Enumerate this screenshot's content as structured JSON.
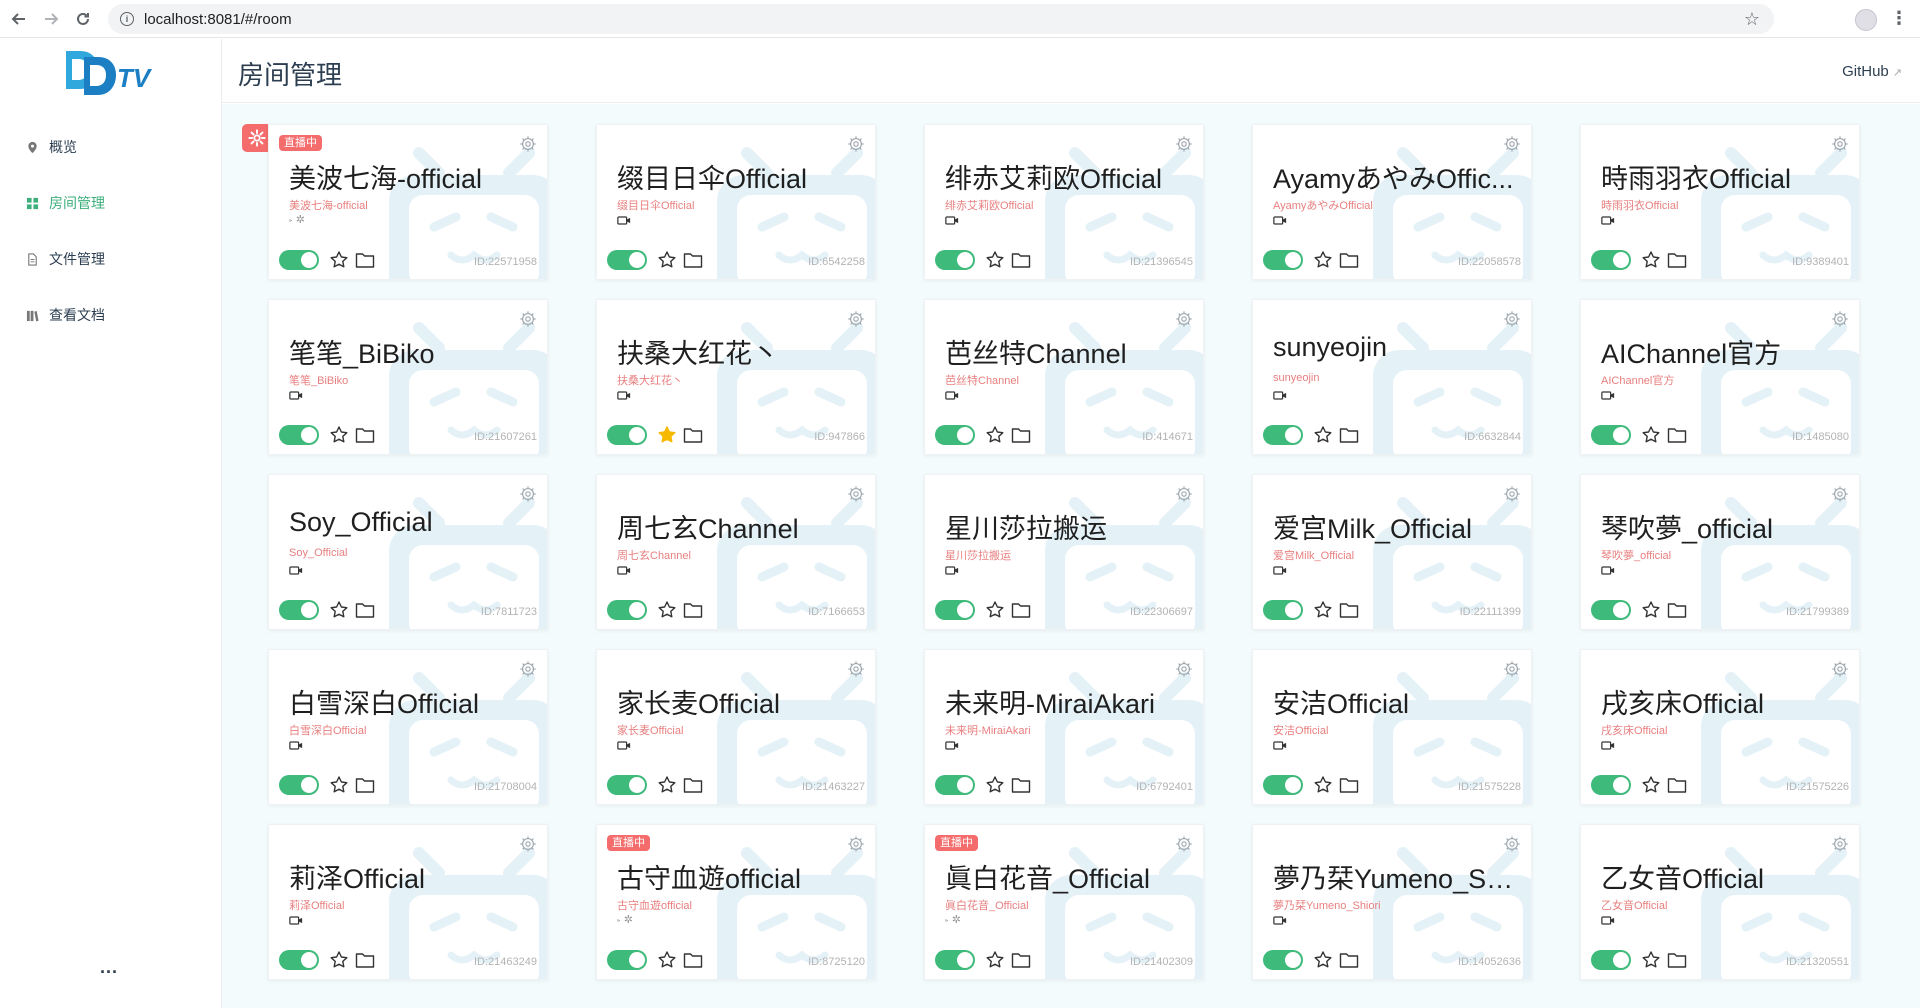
{
  "browser": {
    "url": "localhost:8081/#/room"
  },
  "sidebar": {
    "logo_text": "DDTV",
    "items": [
      {
        "label": "概览",
        "icon": "location-icon",
        "active": false
      },
      {
        "label": "房间管理",
        "icon": "grid-icon",
        "active": true
      },
      {
        "label": "文件管理",
        "icon": "file-icon",
        "active": false
      },
      {
        "label": "查看文档",
        "icon": "book-icon",
        "active": false
      }
    ],
    "more": "..."
  },
  "header": {
    "title": "房间管理",
    "github": "GitHub"
  },
  "colors": {
    "accent": "#3eaf7c",
    "toggle_on": "#3eba7b",
    "live_badge": "#f56c6c",
    "favorite": "#f7b800"
  },
  "badge_label": "直播中",
  "rooms": [
    {
      "name": "美波七海-official",
      "sub": "美波七海-official",
      "id": "ID:22571958",
      "live": true,
      "favorite": false
    },
    {
      "name": "缀目日伞Official",
      "sub": "缀目日伞Official",
      "id": "ID:6542258",
      "live": false,
      "favorite": false
    },
    {
      "name": "绯赤艾莉欧Official",
      "sub": "绯赤艾莉欧Official",
      "id": "ID:21396545",
      "live": false,
      "favorite": false
    },
    {
      "name": "AyamyあやみOffic...",
      "sub": "AyamyあやみOfficial",
      "id": "ID:22058578",
      "live": false,
      "favorite": false
    },
    {
      "name": "時雨羽衣Official",
      "sub": "時雨羽衣Official",
      "id": "ID:9389401",
      "live": false,
      "favorite": false
    },
    {
      "name": "笔笔_BiBiko",
      "sub": "笔笔_BiBiko",
      "id": "ID:21607261",
      "live": false,
      "favorite": false
    },
    {
      "name": "扶桑大红花丶",
      "sub": "扶桑大红花丶",
      "id": "ID:947866",
      "live": false,
      "favorite": true
    },
    {
      "name": "芭丝特Channel",
      "sub": "芭丝特Channel",
      "id": "ID:414671",
      "live": false,
      "favorite": false
    },
    {
      "name": "sunyeojin",
      "sub": "sunyeojin",
      "id": "ID:6632844",
      "live": false,
      "favorite": false
    },
    {
      "name": "AIChannel官方",
      "sub": "AIChannel官方",
      "id": "ID:1485080",
      "live": false,
      "favorite": false
    },
    {
      "name": "Soy_Official",
      "sub": "Soy_Official",
      "id": "ID:7811723",
      "live": false,
      "favorite": false
    },
    {
      "name": "周七玄Channel",
      "sub": "周七玄Channel",
      "id": "ID:7166653",
      "live": false,
      "favorite": false
    },
    {
      "name": "星川莎拉搬运",
      "sub": "星川莎拉搬运",
      "id": "ID:22306697",
      "live": false,
      "favorite": false
    },
    {
      "name": "爱宫Milk_Official",
      "sub": "爱宫Milk_Official",
      "id": "ID:22111399",
      "live": false,
      "favorite": false
    },
    {
      "name": "琴吹夢_official",
      "sub": "琴吹夢_official",
      "id": "ID:21799389",
      "live": false,
      "favorite": false
    },
    {
      "name": "白雪深白Official",
      "sub": "白雪深白Official",
      "id": "ID:21708004",
      "live": false,
      "favorite": false
    },
    {
      "name": "家长麦Official",
      "sub": "家长麦Official",
      "id": "ID:21463227",
      "live": false,
      "favorite": false
    },
    {
      "name": "未来明-MiraiAkari",
      "sub": "未来明-MiraiAkari",
      "id": "ID:6792401",
      "live": false,
      "favorite": false
    },
    {
      "name": "安洁Official",
      "sub": "安洁Official",
      "id": "ID:21575228",
      "live": false,
      "favorite": false
    },
    {
      "name": "戌亥床Official",
      "sub": "戌亥床Official",
      "id": "ID:21575226",
      "live": false,
      "favorite": false
    },
    {
      "name": "莉泽Official",
      "sub": "莉泽Official",
      "id": "ID:21463249",
      "live": false,
      "favorite": false
    },
    {
      "name": "古守血遊official",
      "sub": "古守血遊official",
      "id": "ID:8725120",
      "live": true,
      "favorite": false
    },
    {
      "name": "眞白花音_Official",
      "sub": "眞白花音_Official",
      "id": "ID:21402309",
      "live": true,
      "favorite": false
    },
    {
      "name": "夢乃栞Yumeno_Sh...",
      "sub": "夢乃栞Yumeno_Shiori",
      "id": "ID:14052636",
      "live": false,
      "favorite": false
    },
    {
      "name": "乙女音Official",
      "sub": "乙女音Official",
      "id": "ID:21320551",
      "live": false,
      "favorite": false
    }
  ]
}
